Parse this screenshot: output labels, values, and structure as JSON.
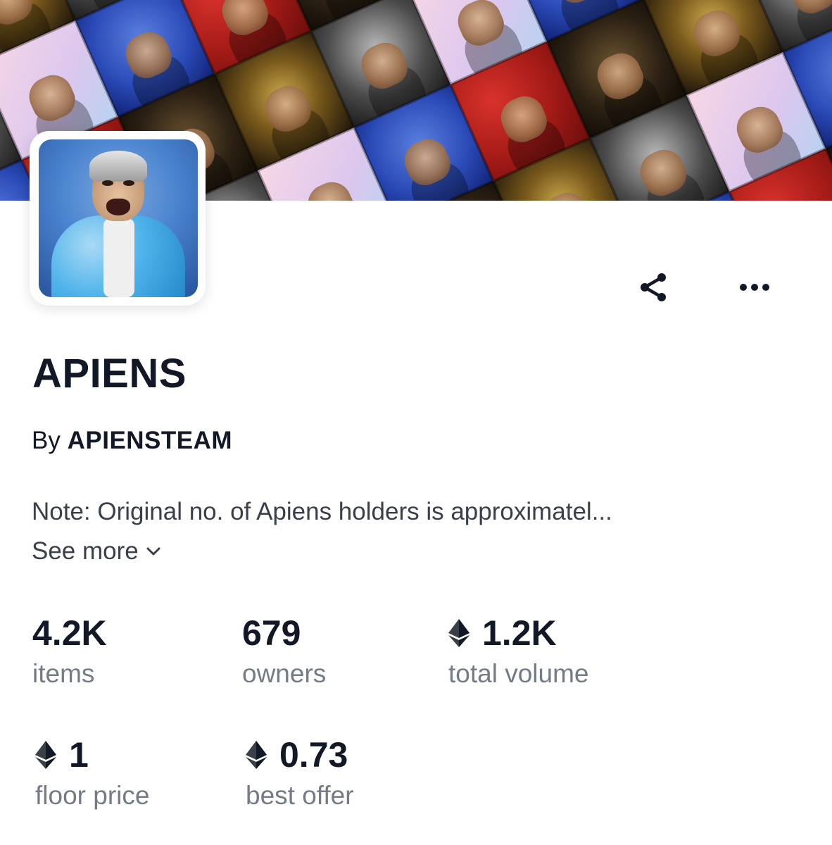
{
  "collection": {
    "name": "APIENS",
    "by_prefix": "By",
    "creator": "APIENSTEAM",
    "description": "Note: Original no. of Apiens holders is approximatel...",
    "see_more_label": "See more"
  },
  "actions": {
    "share_icon": "share-icon",
    "more_icon": "more-options-icon"
  },
  "stats": [
    {
      "value": "4.2K",
      "label": "items",
      "eth": false
    },
    {
      "value": "679",
      "label": "owners",
      "eth": false
    },
    {
      "value": "1.2K",
      "label": "total volume",
      "eth": true
    },
    {
      "value": "1",
      "label": "floor price",
      "eth": true
    },
    {
      "value": "0.73",
      "label": "best offer",
      "eth": true
    }
  ],
  "colors": {
    "text_primary": "#121826",
    "text_secondary": "#747a86",
    "avatar_bg": "#4b84cf"
  }
}
